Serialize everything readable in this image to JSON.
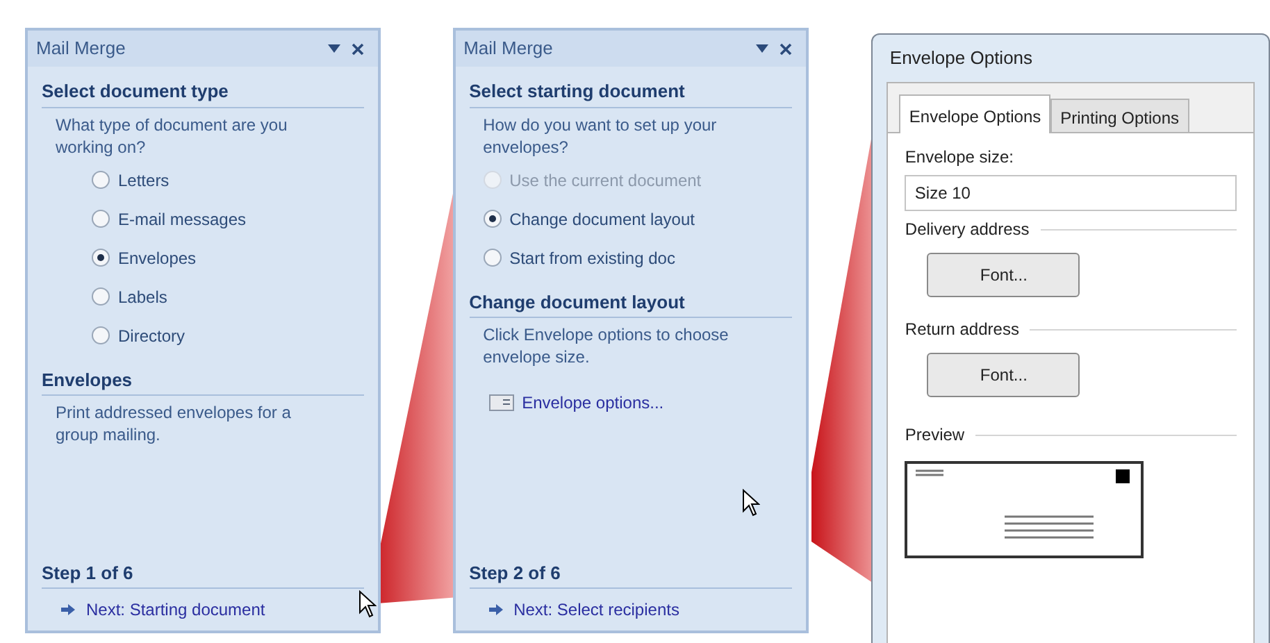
{
  "panes": [
    {
      "title": "Mail Merge",
      "sections": [
        {
          "heading": "Select document type",
          "text": "What type of document are you working on?",
          "options": [
            {
              "label": "Letters",
              "selected": false,
              "disabled": false
            },
            {
              "label": "E-mail messages",
              "selected": false,
              "disabled": false
            },
            {
              "label": "Envelopes",
              "selected": true,
              "disabled": false
            },
            {
              "label": "Labels",
              "selected": false,
              "disabled": false
            },
            {
              "label": "Directory",
              "selected": false,
              "disabled": false
            }
          ]
        },
        {
          "heading": "Envelopes",
          "text": "Print addressed envelopes for a group mailing."
        }
      ],
      "step": "Step 1 of 6",
      "next_link": "Next: Starting document"
    },
    {
      "title": "Mail Merge",
      "sections": [
        {
          "heading": "Select starting document",
          "text": "How do you want to set up your envelopes?",
          "options": [
            {
              "label": "Use the current document",
              "selected": false,
              "disabled": true
            },
            {
              "label": "Change document layout",
              "selected": true,
              "disabled": false
            },
            {
              "label": "Start from existing doc",
              "selected": false,
              "disabled": false
            }
          ]
        },
        {
          "heading": "Change document layout",
          "text": "Click Envelope options to choose envelope size.",
          "link": "Envelope options..."
        }
      ],
      "step": "Step 2 of 6",
      "next_link": "Next: Select recipients"
    }
  ],
  "dialog": {
    "title": "Envelope Options",
    "tabs": [
      {
        "label": "Envelope Options",
        "selected": true
      },
      {
        "label": "Printing Options",
        "selected": false
      }
    ],
    "envelope_size_label": "Envelope size:",
    "envelope_size": "Size 10",
    "delivery_address": "Delivery address",
    "delivery_font_button": "Font...",
    "return_address": "Return address",
    "return_font_button": "Font...",
    "preview": "Preview"
  }
}
